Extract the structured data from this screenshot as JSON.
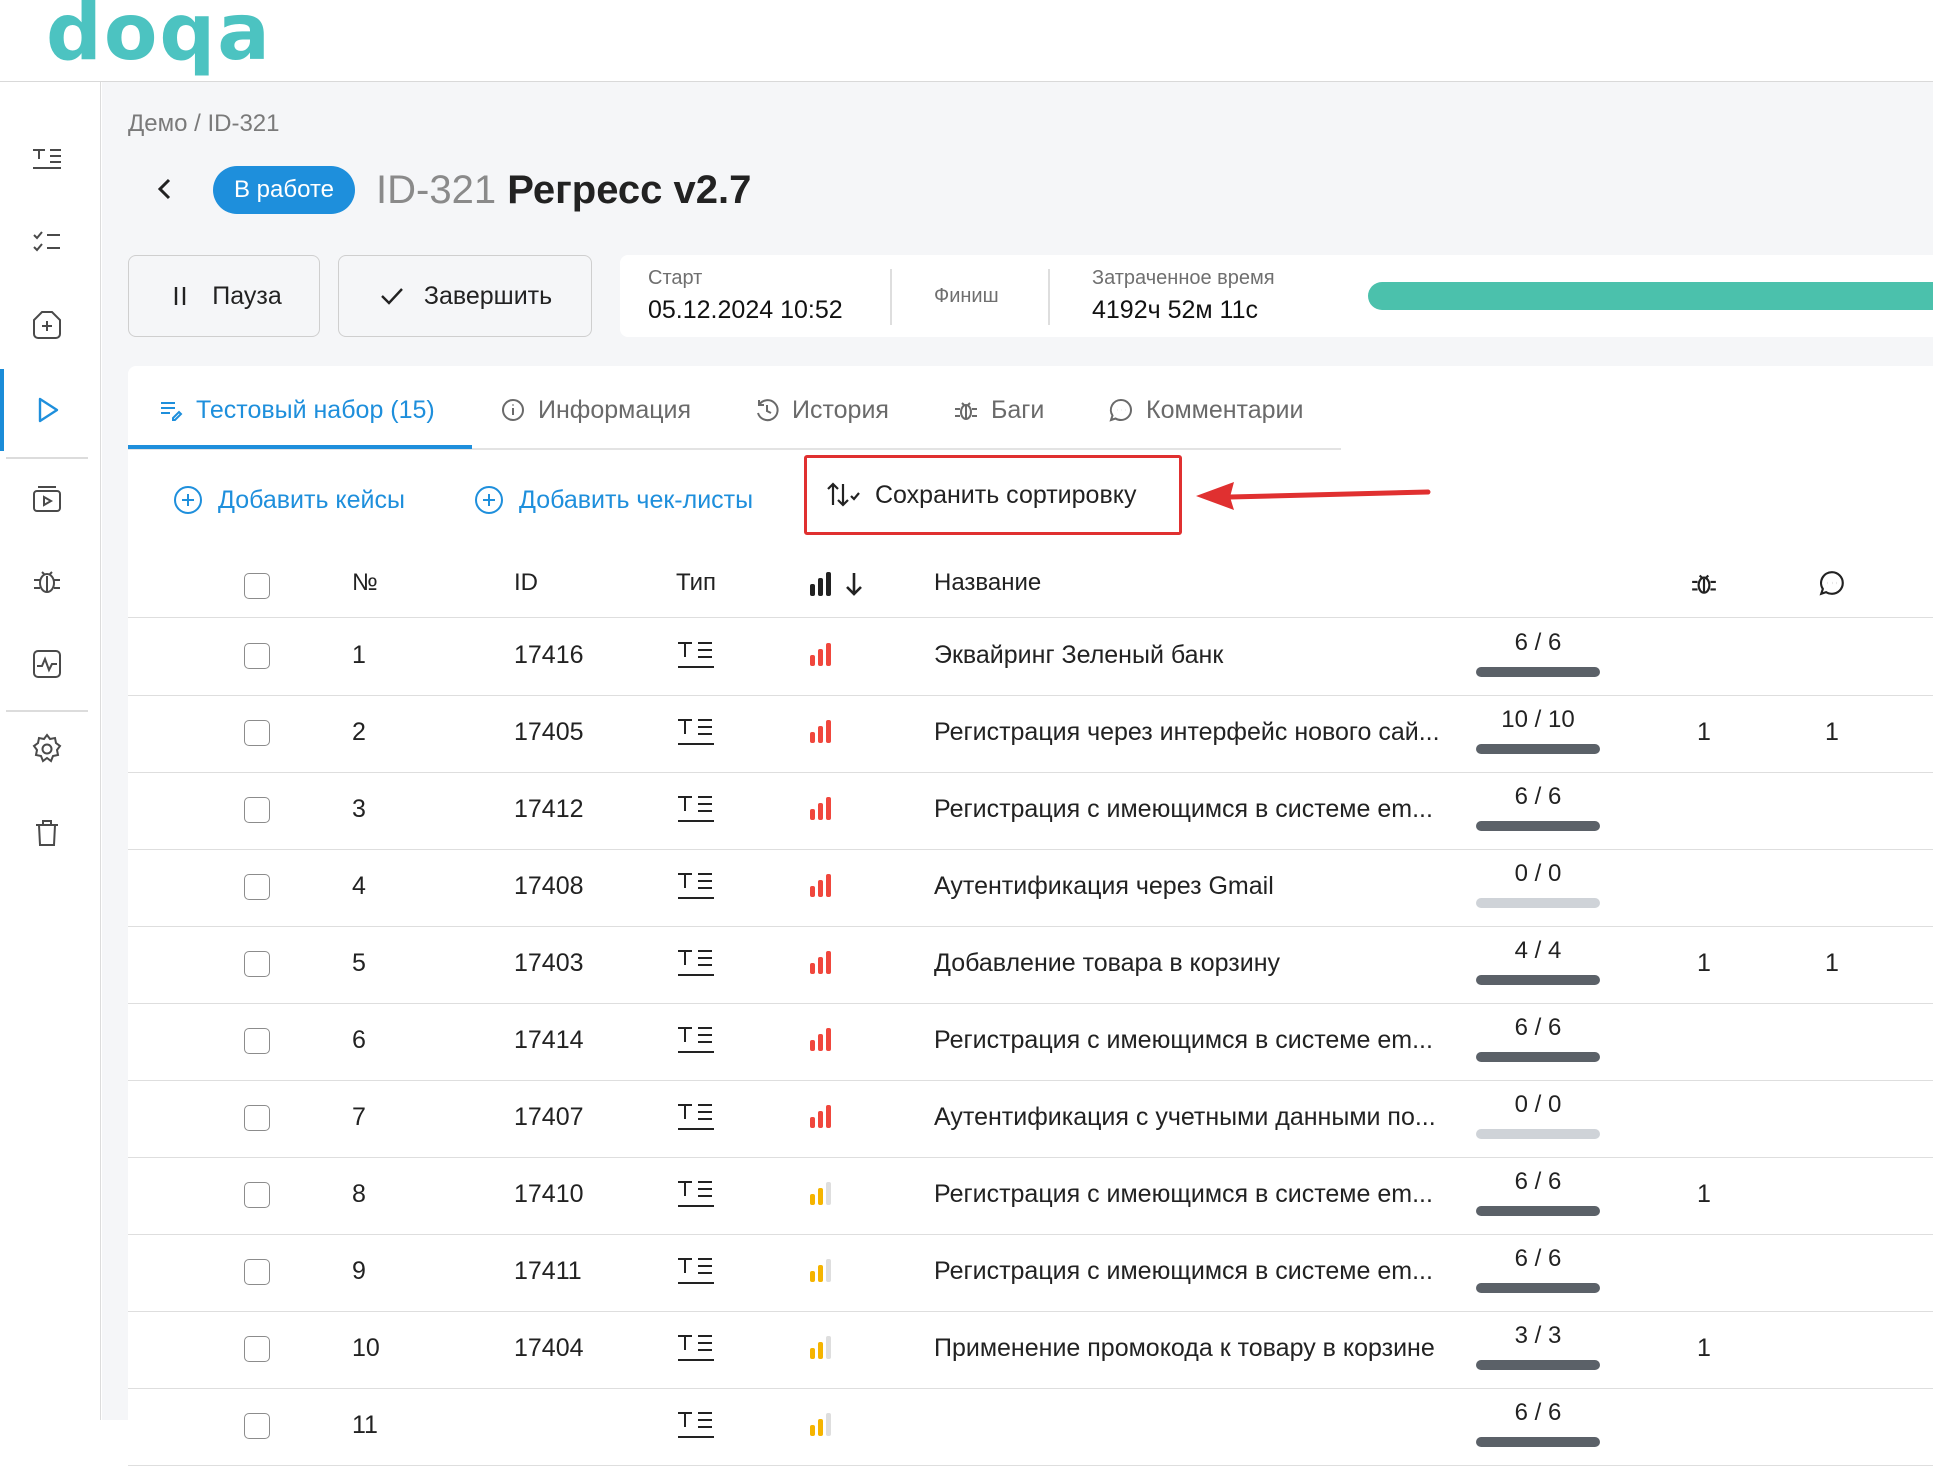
{
  "app": {
    "logo_text": "doqa"
  },
  "breadcrumb": "Демо / ID-321",
  "header": {
    "status": "В работе",
    "run_id": "ID-321",
    "run_name": "Регресс v2.7"
  },
  "controls": {
    "pause_label": "Пауза",
    "finish_label": "Завершить"
  },
  "info": {
    "start_label": "Старт",
    "start_value": "05.12.2024 10:52",
    "finish_label": "Финиш",
    "spent_label": "Затраченное время",
    "spent_value": "4192ч 52м 11с"
  },
  "tabs": [
    {
      "label": "Тестовый набор (15)",
      "icon": "test-suite-icon"
    },
    {
      "label": "Информация",
      "icon": "info-icon"
    },
    {
      "label": "История",
      "icon": "history-icon"
    },
    {
      "label": "Баги",
      "icon": "bug-icon"
    },
    {
      "label": "Комментарии",
      "icon": "comment-icon"
    }
  ],
  "actions": {
    "add_cases": "Добавить кейсы",
    "add_checklists": "Добавить чек-листы",
    "save_sort": "Сохранить сортировку"
  },
  "table": {
    "headers": {
      "num": "№",
      "id": "ID",
      "type": "Тип",
      "name": "Название"
    },
    "rows": [
      {
        "num": "1",
        "id": "17416",
        "priority": "high",
        "name": "Эквайринг Зеленый банк",
        "ratio": "6 / 6",
        "bugs": "",
        "comments": ""
      },
      {
        "num": "2",
        "id": "17405",
        "priority": "high",
        "name": "Регистрация через интерфейс нового сай...",
        "ratio": "10 / 10",
        "bugs": "1",
        "comments": "1"
      },
      {
        "num": "3",
        "id": "17412",
        "priority": "high",
        "name": "Регистрация с имеющимся в системе em...",
        "ratio": "6 / 6",
        "bugs": "",
        "comments": ""
      },
      {
        "num": "4",
        "id": "17408",
        "priority": "high",
        "name": "Аутентификация через Gmail",
        "ratio": "0 / 0",
        "bugs": "",
        "comments": ""
      },
      {
        "num": "5",
        "id": "17403",
        "priority": "high",
        "name": "Добавление товара в корзину",
        "ratio": "4 / 4",
        "bugs": "1",
        "comments": "1"
      },
      {
        "num": "6",
        "id": "17414",
        "priority": "high",
        "name": "Регистрация с имеющимся в системе em...",
        "ratio": "6 / 6",
        "bugs": "",
        "comments": ""
      },
      {
        "num": "7",
        "id": "17407",
        "priority": "high",
        "name": "Аутентификация с учетными данными по...",
        "ratio": "0 / 0",
        "bugs": "",
        "comments": ""
      },
      {
        "num": "8",
        "id": "17410",
        "priority": "medium",
        "name": "Регистрация с имеющимся в системе em...",
        "ratio": "6 / 6",
        "bugs": "1",
        "comments": ""
      },
      {
        "num": "9",
        "id": "17411",
        "priority": "medium",
        "name": "Регистрация с имеющимся в системе em...",
        "ratio": "6 / 6",
        "bugs": "",
        "comments": ""
      },
      {
        "num": "10",
        "id": "17404",
        "priority": "medium",
        "name": "Применение промокода к товару в корзине",
        "ratio": "3 / 3",
        "bugs": "1",
        "comments": ""
      },
      {
        "num": "11",
        "id": "",
        "priority": "medium",
        "name": "",
        "ratio": "6 / 6",
        "bugs": "",
        "comments": ""
      }
    ]
  },
  "colors": {
    "accent": "#1e8fdc",
    "progress": "#4bc1ac",
    "priority_high": "#f0473d",
    "priority_medium": "#f5b400",
    "bar_done": "#5b6168",
    "bar_empty": "#cfd3d8",
    "highlight": "#e03030"
  }
}
